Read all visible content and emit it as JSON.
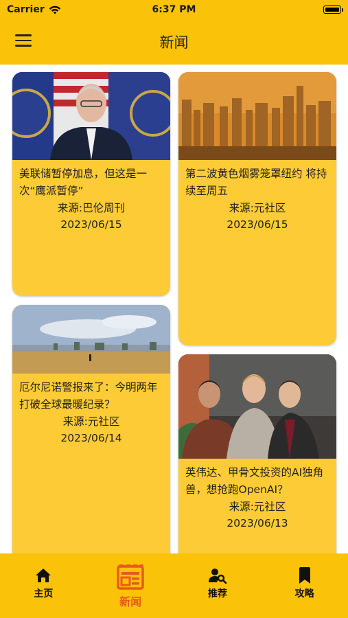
{
  "status_bar": {
    "carrier": "Carrier",
    "time": "6:37 PM"
  },
  "nav": {
    "title": "新闻"
  },
  "news": [
    {
      "title": "美联储暂停加息，但这是一次“鹰派暂停”",
      "source": "来源:巴伦周刊",
      "date": "2023/06/15"
    },
    {
      "title": "第二波黄色烟雾笼罩纽约 将持续至周五",
      "source": "来源:元社区",
      "date": "2023/06/15"
    },
    {
      "title": "厄尔尼诺警报来了：今明两年打破全球最暖纪录？",
      "source": "来源:元社区",
      "date": "2023/06/14"
    },
    {
      "title": "英伟达、甲骨文投资的AI独角兽，想抢跑OpenAI？",
      "source": "来源:元社区",
      "date": "2023/06/13"
    }
  ],
  "tabs": [
    {
      "label": "主页",
      "icon": "home-icon"
    },
    {
      "label": "新闻",
      "icon": "newspaper-icon",
      "active": true
    },
    {
      "label": "推荐",
      "icon": "person-search-icon"
    },
    {
      "label": "攻略",
      "icon": "bookmark-icon"
    }
  ],
  "colors": {
    "accent": "#FBC20A",
    "card": "#FCCB35",
    "active_tab": "#E85A1C"
  }
}
